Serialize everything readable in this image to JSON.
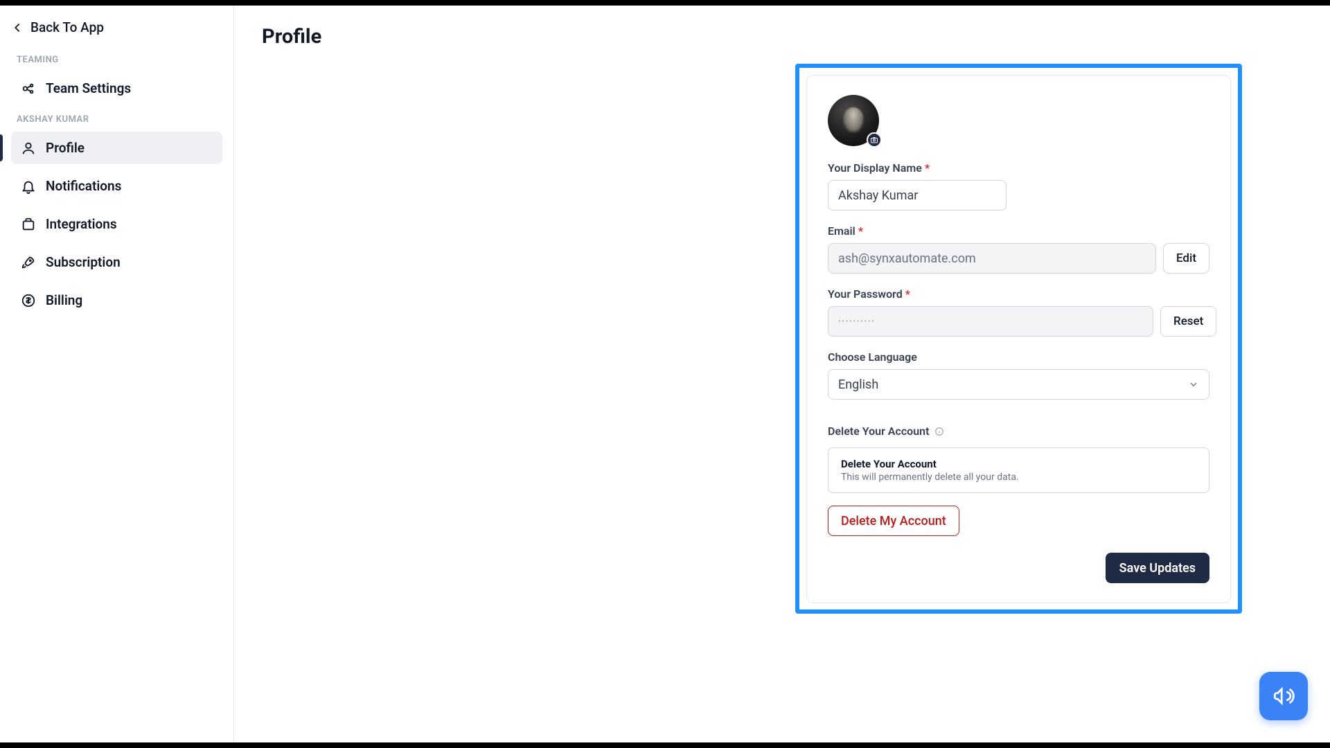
{
  "back_link": "Back To App",
  "page_title": "Profile",
  "sidebar": {
    "section_teaming": "TEAMING",
    "section_user": "AKSHAY KUMAR",
    "team_settings": "Team Settings",
    "profile": "Profile",
    "notifications": "Notifications",
    "integrations": "Integrations",
    "subscription": "Subscription",
    "billing": "Billing"
  },
  "form": {
    "display_name_label": "Your Display Name",
    "display_name_value": "Akshay Kumar",
    "email_label": "Email",
    "email_value": "ash@synxautomate.com",
    "edit_label": "Edit",
    "password_label": "Your Password",
    "password_mask": "••••••••••",
    "reset_label": "Reset",
    "language_label": "Choose Language",
    "language_value": "English",
    "delete_heading": "Delete Your Account",
    "delete_box_title": "Delete Your Account",
    "delete_box_desc": "This will permanently delete all your data.",
    "delete_btn": "Delete My Account",
    "save_btn": "Save Updates"
  }
}
